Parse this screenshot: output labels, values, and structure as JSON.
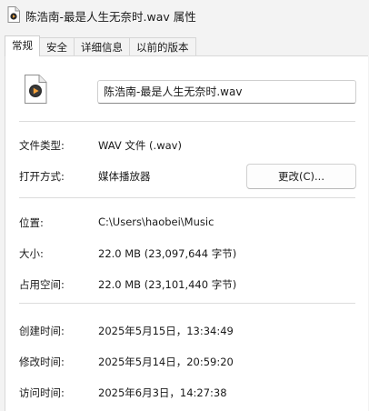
{
  "window": {
    "title": "陈浩南-最是人生无奈时.wav 属性"
  },
  "tabs": [
    {
      "label": "常规",
      "active": true
    },
    {
      "label": "安全"
    },
    {
      "label": "详细信息"
    },
    {
      "label": "以前的版本"
    }
  ],
  "general": {
    "file_name": "陈浩南-最是人生无奈时.wav",
    "file_type_label": "文件类型:",
    "file_type_value": "WAV 文件 (.wav)",
    "opens_with_label": "打开方式:",
    "opens_with_value": "媒体播放器",
    "change_button": "更改(C)...",
    "location_label": "位置:",
    "location_value": "C:\\Users\\haobei\\Music",
    "size_label": "大小:",
    "size_value": "22.0 MB (23,097,644 字节)",
    "size_on_disk_label": "占用空间:",
    "size_on_disk_value": "22.0 MB (23,101,440 字节)",
    "created_label": "创建时间:",
    "created_value": "2025年5月15日，13:34:49",
    "modified_label": "修改时间:",
    "modified_value": "2025年5月14日，20:59:20",
    "accessed_label": "访问时间:",
    "accessed_value": "2025年6月3日，14:27:38"
  },
  "icons": {
    "title_icon": "media-file-icon",
    "file_icon": "media-file-icon"
  }
}
